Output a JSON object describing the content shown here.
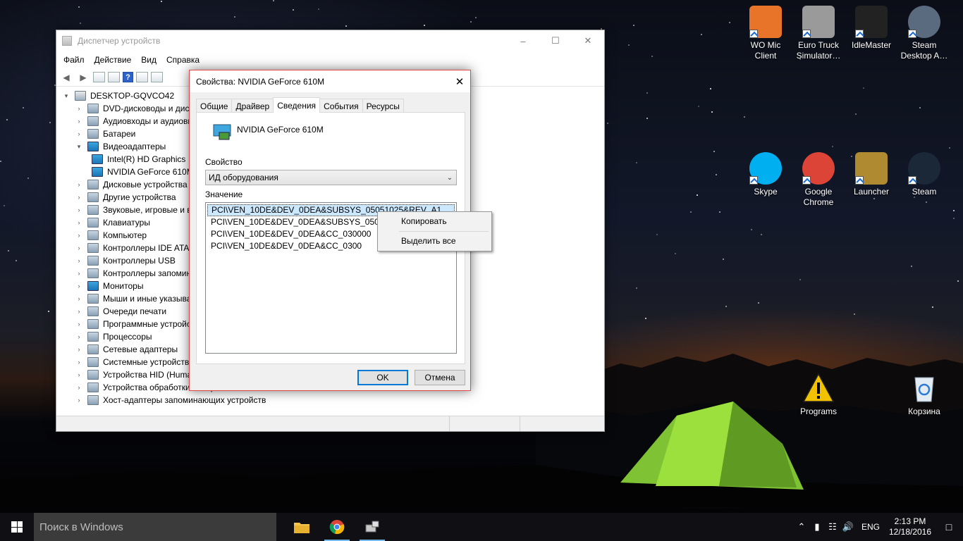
{
  "device_manager": {
    "title": "Диспетчер устройств",
    "menu": [
      "Файл",
      "Действие",
      "Вид",
      "Справка"
    ],
    "tree": [
      {
        "label": "DESKTOP-GQVCO42",
        "level": 0,
        "expander": "▾",
        "icon": "computer-icon"
      },
      {
        "label": "DVD-дисководы и дисководы компакт-дисков",
        "level": 1,
        "expander": "›",
        "icon": "dvd-icon"
      },
      {
        "label": "Аудиовходы и аудиовыходы",
        "level": 1,
        "expander": "›",
        "icon": "audio-icon"
      },
      {
        "label": "Батареи",
        "level": 1,
        "expander": "›",
        "icon": "battery-icon"
      },
      {
        "label": "Видеоадаптеры",
        "level": 1,
        "expander": "▾",
        "icon": "display-adapter-icon"
      },
      {
        "label": "Intel(R) HD Graphics",
        "level": 2,
        "expander": "",
        "icon": "display-adapter-icon"
      },
      {
        "label": "NVIDIA GeForce 610M",
        "level": 2,
        "expander": "",
        "icon": "display-adapter-icon"
      },
      {
        "label": "Дисковые устройства",
        "level": 1,
        "expander": "›",
        "icon": "disk-icon"
      },
      {
        "label": "Другие устройства",
        "level": 1,
        "expander": "›",
        "icon": "other-device-icon"
      },
      {
        "label": "Звуковые, игровые и видеоустройства",
        "level": 1,
        "expander": "›",
        "icon": "sound-icon"
      },
      {
        "label": "Клавиатуры",
        "level": 1,
        "expander": "›",
        "icon": "keyboard-icon"
      },
      {
        "label": "Компьютер",
        "level": 1,
        "expander": "›",
        "icon": "computer-icon"
      },
      {
        "label": "Контроллеры IDE ATA/ATAPI",
        "level": 1,
        "expander": "›",
        "icon": "ide-controller-icon"
      },
      {
        "label": "Контроллеры USB",
        "level": 1,
        "expander": "›",
        "icon": "usb-icon"
      },
      {
        "label": "Контроллеры запоминающих устройств",
        "level": 1,
        "expander": "›",
        "icon": "storage-controller-icon"
      },
      {
        "label": "Мониторы",
        "level": 1,
        "expander": "›",
        "icon": "monitor-icon"
      },
      {
        "label": "Мыши и иные указывающие устройства",
        "level": 1,
        "expander": "›",
        "icon": "mouse-icon"
      },
      {
        "label": "Очереди печати",
        "level": 1,
        "expander": "›",
        "icon": "printer-icon"
      },
      {
        "label": "Программные устройства",
        "level": 1,
        "expander": "›",
        "icon": "software-device-icon"
      },
      {
        "label": "Процессоры",
        "level": 1,
        "expander": "›",
        "icon": "processor-icon"
      },
      {
        "label": "Сетевые адаптеры",
        "level": 1,
        "expander": "›",
        "icon": "network-adapter-icon"
      },
      {
        "label": "Системные устройства",
        "level": 1,
        "expander": "›",
        "icon": "system-device-icon"
      },
      {
        "label": "Устройства HID (Human Interface Devices)",
        "level": 1,
        "expander": "›",
        "icon": "hid-icon"
      },
      {
        "label": "Устройства обработки изображений",
        "level": 1,
        "expander": "›",
        "icon": "imaging-device-icon"
      },
      {
        "label": "Хост-адаптеры запоминающих устройств",
        "level": 1,
        "expander": "›",
        "icon": "storage-host-adapter-icon"
      }
    ]
  },
  "properties_dialog": {
    "title": "Свойства: NVIDIA GeForce 610M",
    "close_glyph": "✕",
    "tabs": [
      "Общие",
      "Драйвер",
      "Сведения",
      "События",
      "Ресурсы"
    ],
    "active_tab": "Сведения",
    "device_name": "NVIDIA GeForce 610M",
    "property_label": "Свойство",
    "property_value": "ИД оборудования",
    "value_label": "Значение",
    "values": [
      "PCI\\VEN_10DE&DEV_0DEA&SUBSYS_05051025&REV_A1",
      "PCI\\VEN_10DE&DEV_0DEA&SUBSYS_05051025",
      "PCI\\VEN_10DE&DEV_0DEA&CC_030000",
      "PCI\\VEN_10DE&DEV_0DEA&CC_0300"
    ],
    "ok_label": "OK",
    "cancel_label": "Отмена"
  },
  "context_menu": {
    "items": [
      "Копировать",
      "Выделить все"
    ]
  },
  "desktop_icons": [
    {
      "label": "WO Mic Client",
      "icon": "microphone-icon",
      "color": "#e8742a"
    },
    {
      "label": "Euro Truck Simulator…",
      "icon": "euro-truck-icon",
      "color": "#9a9a9a"
    },
    {
      "label": "IdleMaster",
      "icon": "idlemaster-icon",
      "color": "#222222"
    },
    {
      "label": "Steam Desktop A…",
      "icon": "lock-icon",
      "color": "#5a6b80"
    },
    {
      "label": "Skype",
      "icon": "skype-icon",
      "color": "#00aff0"
    },
    {
      "label": "Google Chrome",
      "icon": "chrome-icon",
      "color": "#db4437"
    },
    {
      "label": "Launcher",
      "icon": "launcher-icon",
      "color": "#b08a30"
    },
    {
      "label": "Steam",
      "icon": "steam-icon",
      "color": "#1b2838"
    },
    {
      "label": "Programs",
      "icon": "warning-icon",
      "color": "#f2c200"
    },
    {
      "label": "Корзина",
      "icon": "recycle-bin-icon",
      "color": "#cfd8e0"
    }
  ],
  "taskbar": {
    "search_placeholder": "Поиск в Windows",
    "apps": [
      "file-explorer-icon",
      "chrome-icon",
      "device-manager-icon"
    ],
    "language": "ENG",
    "time": "2:13 PM",
    "date": "12/18/2016"
  }
}
